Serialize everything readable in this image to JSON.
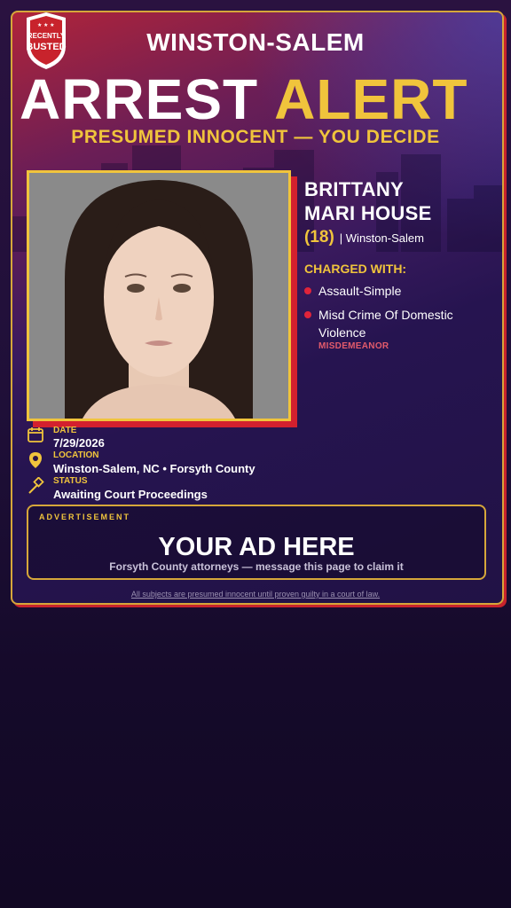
{
  "brand": {
    "badge_line1": "RECENTLY",
    "badge_line2": "BUSTED"
  },
  "header": {
    "city": "WINSTON-SALEM",
    "headline_word1": "ARREST",
    "headline_word2": "ALERT",
    "tagline": "PRESUMED INNOCENT — YOU DECIDE"
  },
  "subject": {
    "name_line1": "BRITTANY",
    "name_line2": "MARI HOUSE",
    "age": "(18)",
    "residence": "| Winston-Salem"
  },
  "charges": {
    "heading": "CHARGED WITH:",
    "items": [
      {
        "text": "Assault-Simple",
        "severity": ""
      },
      {
        "text": "Misd Crime Of Domestic Violence",
        "severity": "MISDEMEANOR"
      }
    ]
  },
  "details": {
    "date_label": "DATE",
    "date_value": "7/29/2026",
    "location_label": "LOCATION",
    "location_value": "Winston-Salem, NC • Forsyth County",
    "status_label": "STATUS",
    "status_value": "Awaiting Court Proceedings"
  },
  "ad": {
    "label": "ADVERTISEMENT",
    "title": "YOUR AD HERE",
    "subtitle": "Forsyth County attorneys — message this page to claim it"
  },
  "footer": {
    "disclaimer": "All subjects are presumed innocent until proven guilty in a court of law."
  },
  "icons": {
    "date": "calendar-icon",
    "location": "map-pin-icon",
    "status": "gavel-icon"
  },
  "colors": {
    "accent_gold": "#f0c43c",
    "accent_red": "#d3202e",
    "background": "#1f0f38"
  }
}
